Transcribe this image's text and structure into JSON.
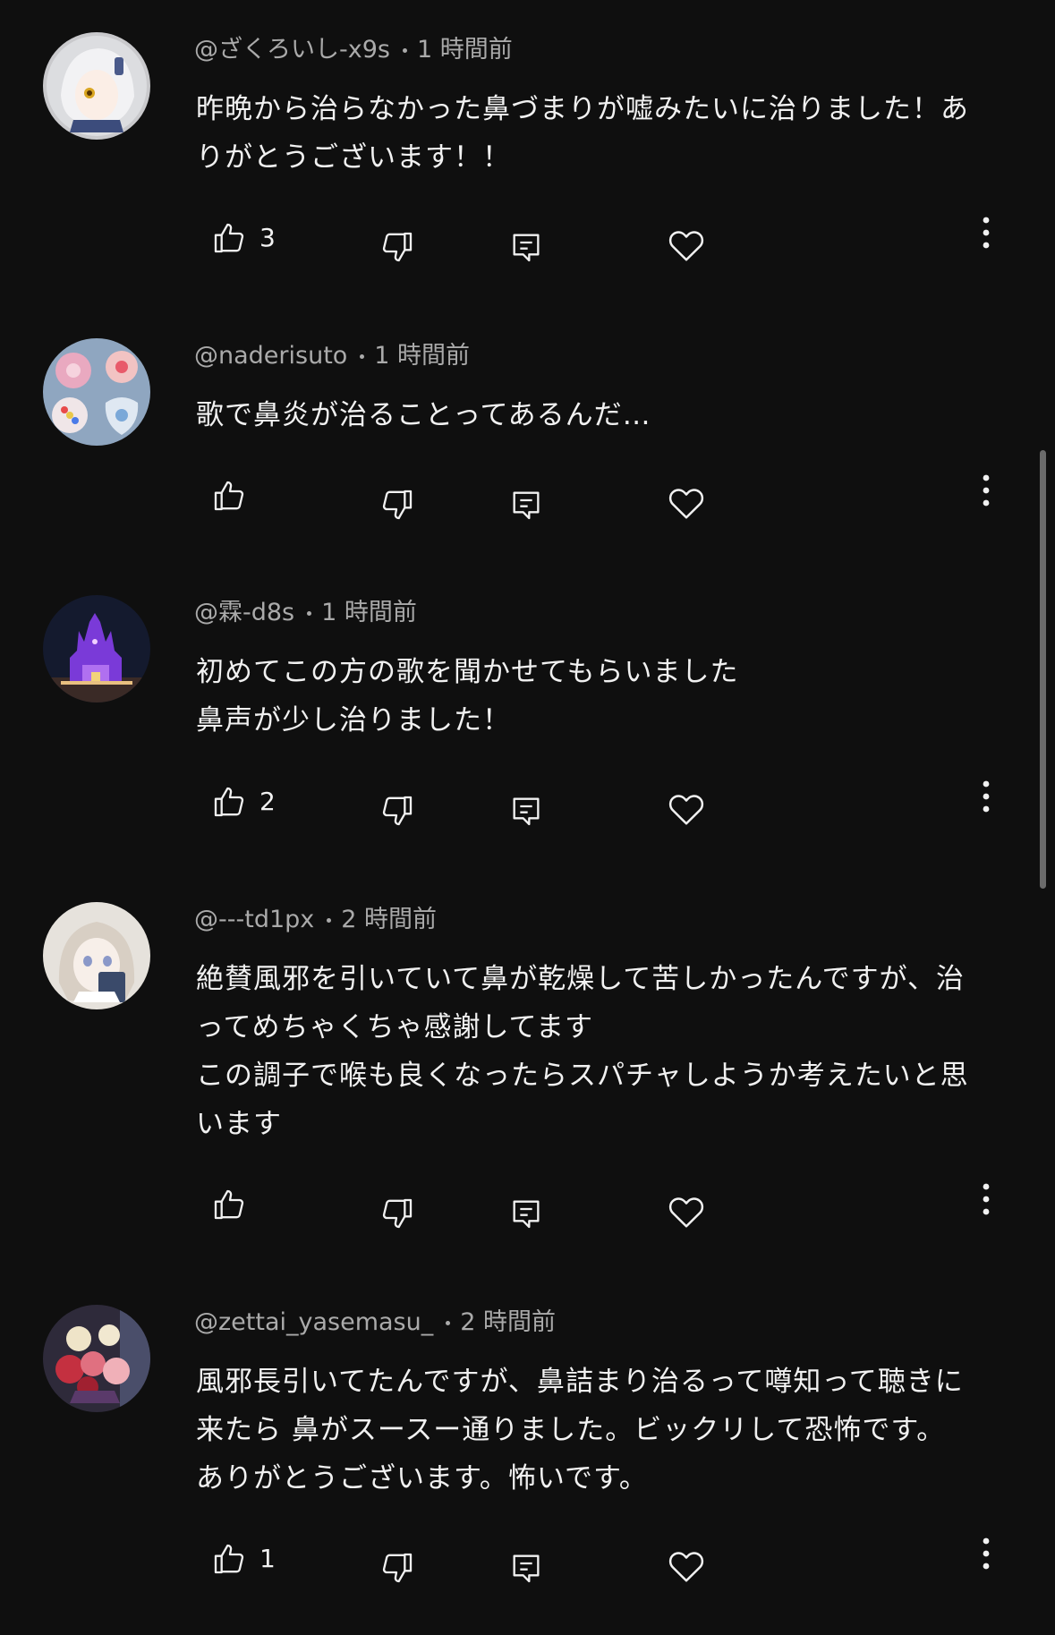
{
  "comments": [
    {
      "author": "@ざくろいし-x9s",
      "time": "1 時間前",
      "lines": [
        "昨晩から治らなかった鼻づまりが嘘みたいに治りました！あ",
        "りがとうございます！！"
      ],
      "likes": "3"
    },
    {
      "author": "@naderisuto",
      "time": "1 時間前",
      "lines": [
        "歌で鼻炎が治ることってあるんだ…"
      ],
      "likes": ""
    },
    {
      "author": "@霖-d8s",
      "time": "1 時間前",
      "lines": [
        "初めてこの方の歌を聞かせてもらいました",
        "鼻声が少し治りました！"
      ],
      "likes": "2"
    },
    {
      "author": "@---td1px",
      "time": "2 時間前",
      "lines": [
        "絶賛風邪を引いていて鼻が乾燥して苦しかったんですが、治",
        "ってめちゃくちゃ感謝してます",
        "この調子で喉も良くなったらスパチャしようか考えたいと思",
        "います"
      ],
      "likes": ""
    },
    {
      "author": "@zettai_yasemasu_",
      "time": "2 時間前",
      "lines": [
        "風邪長引いてたんですが、鼻詰まり治るって噂知って聴きに",
        "来たら 鼻がスースー通りました。ビックリして恐怖です。",
        "ありがとうございます。怖いです。"
      ],
      "likes": "1"
    }
  ],
  "icons": {
    "like": "thumb-up-icon",
    "dislike": "thumb-down-icon",
    "reply": "reply-icon",
    "heart": "heart-icon",
    "more": "more-vert-icon"
  },
  "colors": {
    "background": "#0f0f0f",
    "text": "#f1f1f1",
    "secondary_text": "#aaaaaa"
  }
}
